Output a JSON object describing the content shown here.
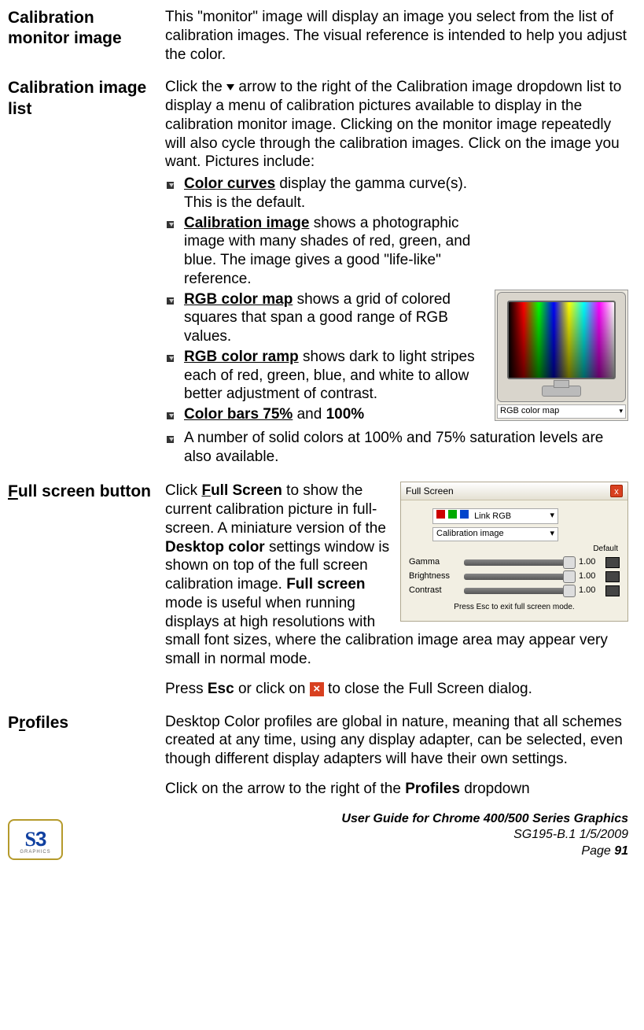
{
  "sections": {
    "calibMonitor": {
      "label": "Calibration monitor image",
      "body": "This \"monitor\" image will display an image you select from the list of calibration images. The visual reference is intended to help you adjust the color."
    },
    "calibList": {
      "label": "Calibration image list",
      "intro_a": "Click the ",
      "intro_b": " arrow to the right of the Calibration image dropdown list to display a menu of calibration pictures available to display in the calibration monitor image. Clicking on the monitor image repeatedly will also cycle through the calibration images. Click on the image you want. Pictures include:",
      "items": [
        {
          "bold": "Color curves",
          "rest": " display the gamma curve(s). This is the default."
        },
        {
          "bold": "Calibration image",
          "rest": " shows a photographic image with many shades of red, green, and blue. The image gives a good \"life-like\" reference."
        },
        {
          "bold": "RGB color map",
          "rest": " shows a grid of colored squares that span a good range of RGB values."
        },
        {
          "bold": "RGB color ramp",
          "rest": " shows dark to light stripes each of red, green, blue, and white to allow better adjustment of contrast."
        },
        {
          "bold": "Color bars 75%",
          "mid": " and ",
          "bold2": "100%",
          "rest": ""
        },
        {
          "bold": "",
          "rest": "A number of solid colors at 100% and 75% saturation levels are also available."
        }
      ],
      "dropdown_caption": "RGB color map"
    },
    "fullScreen": {
      "label": "Full screen button",
      "text_a": "Click ",
      "text_b": "ull Screen",
      "text_c": " to show the current calibration picture in full-screen. A miniature version of the ",
      "text_d": "Desktop color",
      "text_e": " settings window is shown on top of the full screen calibration image. ",
      "text_f": "Full screen",
      "text_g": " mode is useful when running displays at high resolutions with small font sizes, where the calibration image area may appear very small in normal mode.",
      "press_a": "Press ",
      "press_esc": "Esc",
      "press_b": " or click on ",
      "press_c": " to close the Full Screen dialog.",
      "figure": {
        "title": "Full Screen",
        "dd1": "Link RGB",
        "dd2": "Calibration image",
        "default": "Default",
        "rows": [
          {
            "label": "Gamma",
            "value": "1.00"
          },
          {
            "label": "Brightness",
            "value": "1.00"
          },
          {
            "label": "Contrast",
            "value": "1.00"
          }
        ],
        "esc": "Press Esc to exit full screen mode."
      }
    },
    "profiles": {
      "label_pre": "P",
      "label_u": "r",
      "label_post": "ofiles",
      "body": "Desktop Color profiles are global in nature, meaning that all schemes created at any time, using any display adapter, can be selected, even though different display adapters will have their own settings.",
      "body2_a": "Click on the arrow to the right of the ",
      "body2_b": "Profiles",
      "body2_c": " dropdown"
    }
  },
  "footer": {
    "line1": "User Guide for Chrome 400/500 Series Graphics",
    "line2": "SG195-B.1   1/5/2009",
    "page_label": "Page ",
    "page_no": "91",
    "logo_tag": "GRAPHICS"
  }
}
